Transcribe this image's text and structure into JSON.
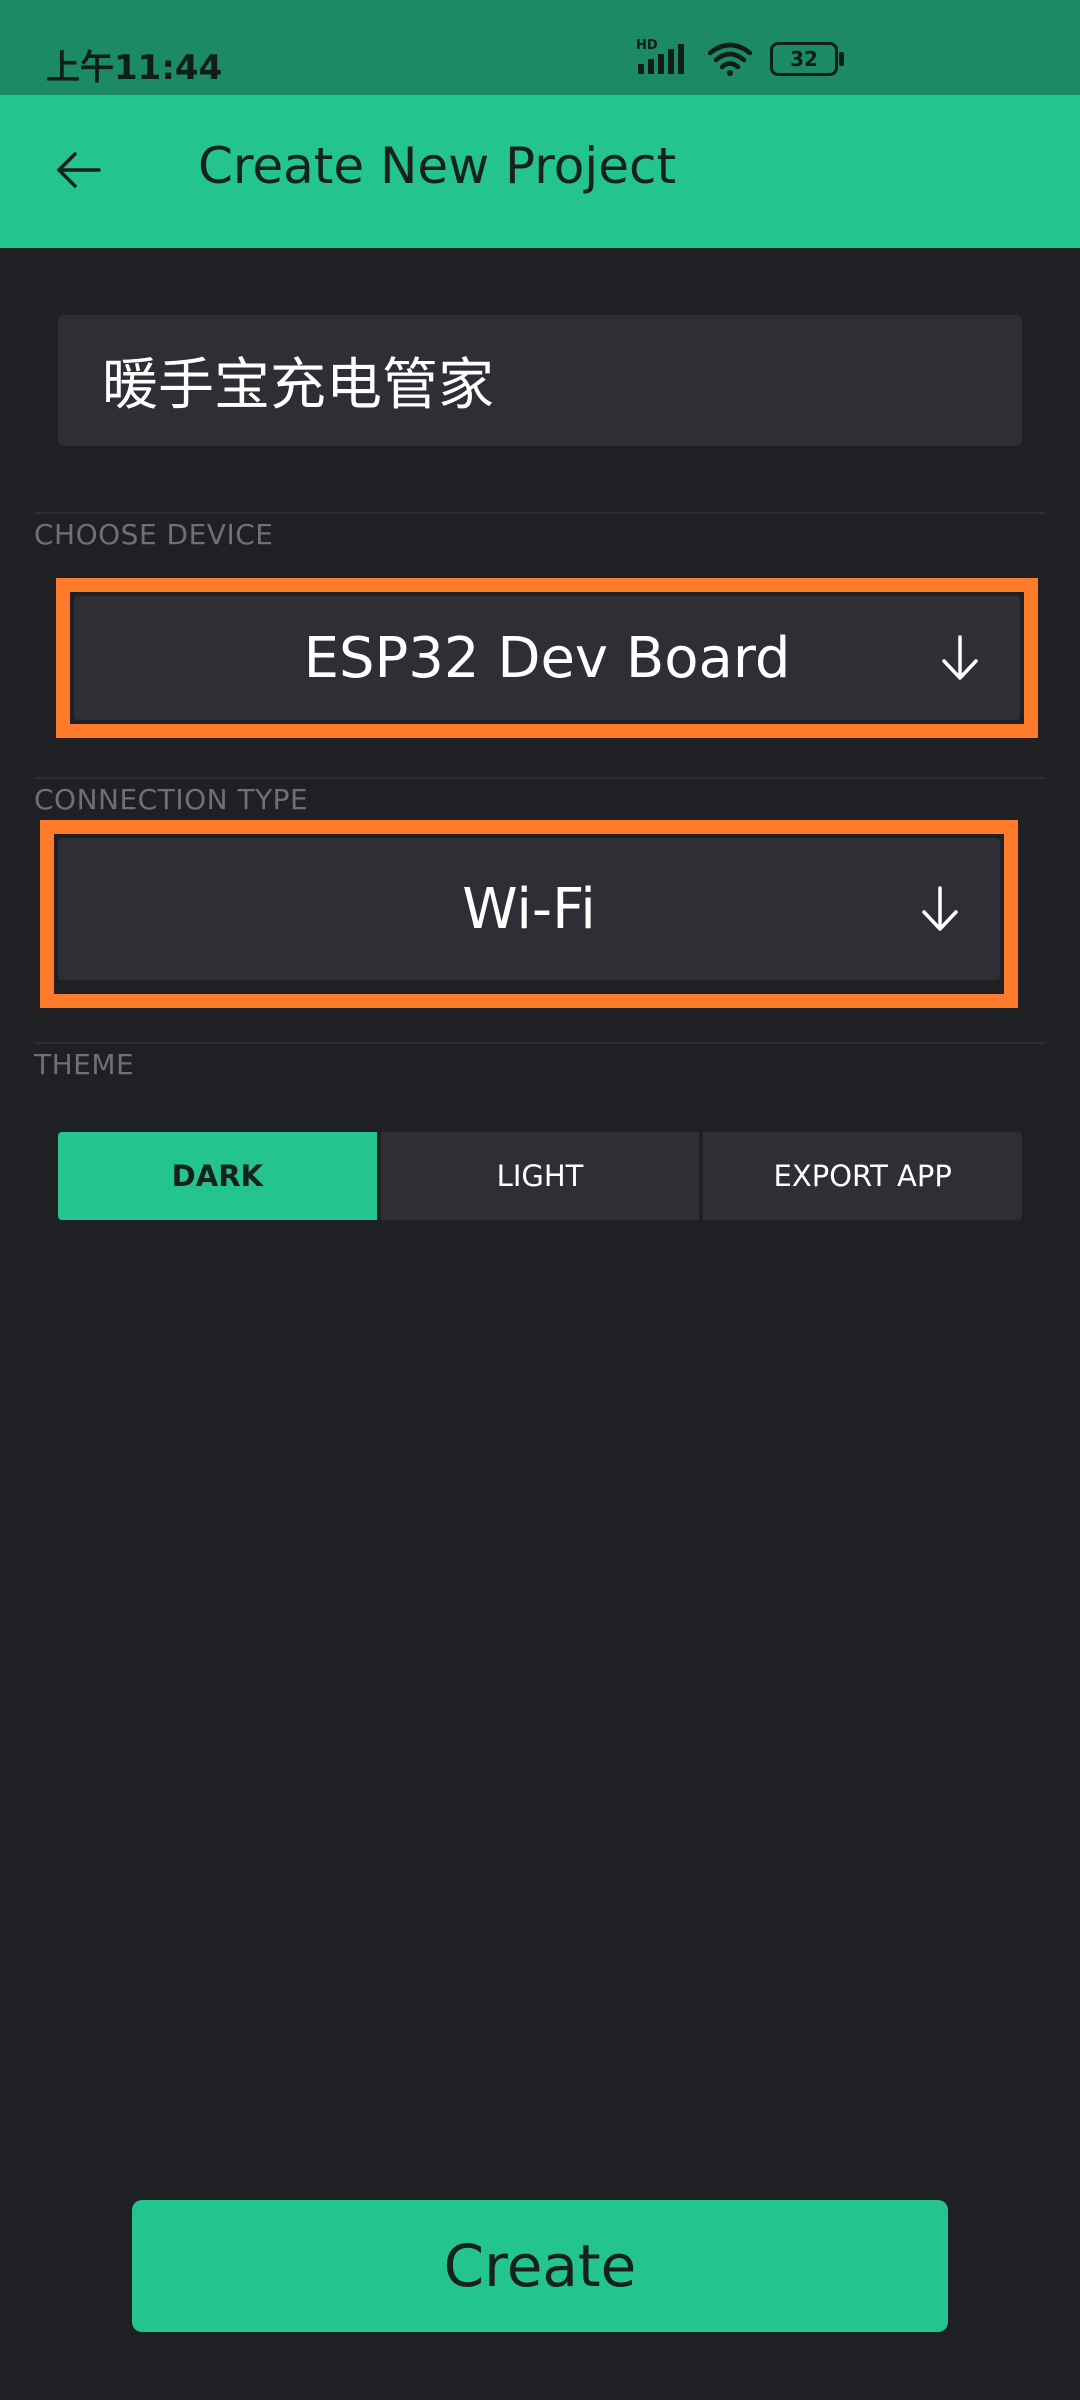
{
  "status_bar": {
    "time": "上午11:44",
    "network_badge": "HD",
    "battery_level": "32",
    "icons": [
      "signal-icon",
      "wifi-icon",
      "battery-icon"
    ]
  },
  "app_bar": {
    "title": "Create New Project",
    "back_icon": "arrow-left-icon"
  },
  "project_name": {
    "value": "暖手宝充电管家"
  },
  "device": {
    "section_label": "CHOOSE DEVICE",
    "selected": "ESP32 Dev Board",
    "arrow_icon": "arrow-down-icon"
  },
  "connection": {
    "section_label": "CONNECTION TYPE",
    "selected": "Wi-Fi",
    "arrow_icon": "arrow-down-icon"
  },
  "theme": {
    "section_label": "THEME",
    "options": [
      {
        "label": "DARK",
        "active": true
      },
      {
        "label": "LIGHT",
        "active": false
      },
      {
        "label": "EXPORT APP",
        "active": false
      }
    ]
  },
  "create_button": {
    "label": "Create"
  },
  "colors": {
    "accent": "#23c48e",
    "status_bar": "#1c8a64",
    "background": "#1f2024",
    "field": "#2e2f34",
    "highlight": "#ff7a2b",
    "section_label": "#6e7076"
  }
}
